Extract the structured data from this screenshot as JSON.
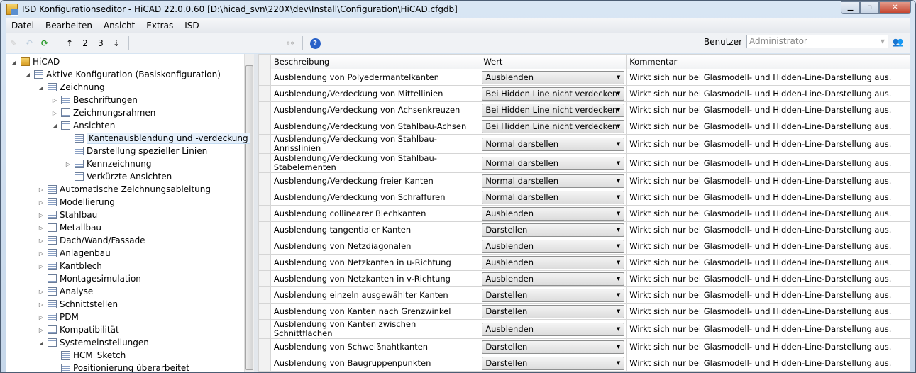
{
  "window": {
    "title": "ISD Konfigurationseditor  - HiCAD 22.0.0.60 [D:\\hicad_svn\\220X\\dev\\Install\\Configuration\\HiCAD.cfgdb]"
  },
  "menu": [
    "Datei",
    "Bearbeiten",
    "Ansicht",
    "Extras",
    "ISD"
  ],
  "toolbar": {
    "level2": "2",
    "level3": "3",
    "user_label": "Benutzer",
    "user_value": "Administrator"
  },
  "tree": [
    {
      "label": "HiCAD",
      "level": 0,
      "exp": "open",
      "root": true
    },
    {
      "label": "Aktive Konfiguration (Basiskonfiguration)",
      "level": 1,
      "exp": "open"
    },
    {
      "label": "Zeichnung",
      "level": 2,
      "exp": "open"
    },
    {
      "label": "Beschriftungen",
      "level": 3,
      "exp": "closed"
    },
    {
      "label": "Zeichnungsrahmen",
      "level": 3,
      "exp": "closed"
    },
    {
      "label": "Ansichten",
      "level": 3,
      "exp": "open"
    },
    {
      "label": "Kantenausblendung und -verdeckung",
      "level": 4,
      "exp": "none",
      "selected": true
    },
    {
      "label": "Darstellung spezieller Linien",
      "level": 4,
      "exp": "none"
    },
    {
      "label": "Kennzeichnung",
      "level": 4,
      "exp": "closed"
    },
    {
      "label": "Verkürzte Ansichten",
      "level": 4,
      "exp": "none"
    },
    {
      "label": "Automatische Zeichnungsableitung",
      "level": 2,
      "exp": "closed"
    },
    {
      "label": "Modellierung",
      "level": 2,
      "exp": "closed"
    },
    {
      "label": "Stahlbau",
      "level": 2,
      "exp": "closed"
    },
    {
      "label": "Metallbau",
      "level": 2,
      "exp": "closed"
    },
    {
      "label": "Dach/Wand/Fassade",
      "level": 2,
      "exp": "closed"
    },
    {
      "label": "Anlagenbau",
      "level": 2,
      "exp": "closed"
    },
    {
      "label": "Kantblech",
      "level": 2,
      "exp": "closed"
    },
    {
      "label": "Montagesimulation",
      "level": 2,
      "exp": "none"
    },
    {
      "label": "Analyse",
      "level": 2,
      "exp": "closed"
    },
    {
      "label": "Schnittstellen",
      "level": 2,
      "exp": "closed"
    },
    {
      "label": "PDM",
      "level": 2,
      "exp": "closed"
    },
    {
      "label": "Kompatibilität",
      "level": 2,
      "exp": "closed"
    },
    {
      "label": "Systemeinstellungen",
      "level": 2,
      "exp": "open"
    },
    {
      "label": "HCM_Sketch",
      "level": 3,
      "exp": "none"
    },
    {
      "label": "Positionierung überarbeitet",
      "level": 3,
      "exp": "none"
    }
  ],
  "grid": {
    "headers": [
      "Beschreibung",
      "Wert",
      "Kommentar"
    ],
    "rows": [
      [
        "Ausblendung von Polyedermantelkanten",
        "Ausblenden",
        "Wirkt sich nur bei Glasmodell- und Hidden-Line-Darstellung aus."
      ],
      [
        "Ausblendung/Verdeckung von Mittellinien",
        "Bei Hidden Line nicht verdecken",
        "Wirkt sich nur bei Glasmodell- und Hidden-Line-Darstellung aus."
      ],
      [
        "Ausblendung/Verdeckung von Achsenkreuzen",
        "Bei Hidden Line nicht verdecken",
        "Wirkt sich nur bei Glasmodell- und Hidden-Line-Darstellung aus."
      ],
      [
        "Ausblendung/Verdeckung von Stahlbau-Achsen",
        "Bei Hidden Line nicht verdecken",
        "Wirkt sich nur bei Glasmodell- und Hidden-Line-Darstellung aus."
      ],
      [
        "Ausblendung/Verdeckung von Stahlbau-Anrisslinien",
        "Normal darstellen",
        "Wirkt sich nur bei Glasmodell- und Hidden-Line-Darstellung aus."
      ],
      [
        "Ausblendung/Verdeckung von Stahlbau-Stabelementen",
        "Normal darstellen",
        "Wirkt sich nur bei Glasmodell- und Hidden-Line-Darstellung aus."
      ],
      [
        "Ausblendung/Verdeckung freier Kanten",
        "Normal darstellen",
        "Wirkt sich nur bei Glasmodell- und Hidden-Line-Darstellung aus."
      ],
      [
        "Ausblendung/Verdeckung von Schraffuren",
        "Normal darstellen",
        "Wirkt sich nur bei Glasmodell- und Hidden-Line-Darstellung aus."
      ],
      [
        "Ausblendung collinearer Blechkanten",
        "Ausblenden",
        "Wirkt sich nur bei Glasmodell- und Hidden-Line-Darstellung aus."
      ],
      [
        "Ausblendung tangentialer Kanten",
        "Darstellen",
        "Wirkt sich nur bei Glasmodell- und Hidden-Line-Darstellung aus."
      ],
      [
        "Ausblendung von Netzdiagonalen",
        "Ausblenden",
        "Wirkt sich nur bei Glasmodell- und Hidden-Line-Darstellung aus."
      ],
      [
        "Ausblendung von Netzkanten in u-Richtung",
        "Ausblenden",
        "Wirkt sich nur bei Glasmodell- und Hidden-Line-Darstellung aus."
      ],
      [
        "Ausblendung von Netzkanten in v-Richtung",
        "Ausblenden",
        "Wirkt sich nur bei Glasmodell- und Hidden-Line-Darstellung aus."
      ],
      [
        "Ausblendung einzeln ausgewählter Kanten",
        "Darstellen",
        "Wirkt sich nur bei Glasmodell- und Hidden-Line-Darstellung aus."
      ],
      [
        "Ausblendung von Kanten nach Grenzwinkel",
        "Darstellen",
        "Wirkt sich nur bei Glasmodell- und Hidden-Line-Darstellung aus."
      ],
      [
        "Ausblendung von Kanten zwischen Schnittflächen",
        "Ausblenden",
        "Wirkt sich nur bei Glasmodell- und Hidden-Line-Darstellung aus."
      ],
      [
        "Ausblendung von Schweißnahtkanten",
        "Darstellen",
        "Wirkt sich nur bei Glasmodell- und Hidden-Line-Darstellung aus."
      ],
      [
        "Ausblendung von Baugruppenpunkten",
        "Darstellen",
        "Wirkt sich nur bei Glasmodell- und Hidden-Line-Darstellung aus."
      ]
    ]
  }
}
